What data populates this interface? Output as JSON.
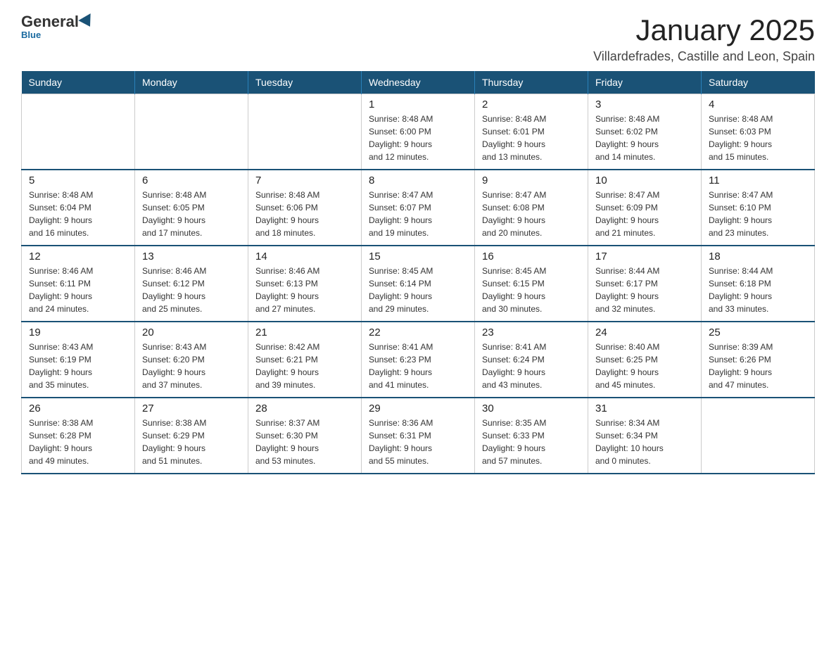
{
  "logo": {
    "general": "General",
    "blue": "Blue"
  },
  "title": "January 2025",
  "subtitle": "Villardefrades, Castille and Leon, Spain",
  "weekdays": [
    "Sunday",
    "Monday",
    "Tuesday",
    "Wednesday",
    "Thursday",
    "Friday",
    "Saturday"
  ],
  "weeks": [
    [
      {
        "day": "",
        "info": ""
      },
      {
        "day": "",
        "info": ""
      },
      {
        "day": "",
        "info": ""
      },
      {
        "day": "1",
        "info": "Sunrise: 8:48 AM\nSunset: 6:00 PM\nDaylight: 9 hours\nand 12 minutes."
      },
      {
        "day": "2",
        "info": "Sunrise: 8:48 AM\nSunset: 6:01 PM\nDaylight: 9 hours\nand 13 minutes."
      },
      {
        "day": "3",
        "info": "Sunrise: 8:48 AM\nSunset: 6:02 PM\nDaylight: 9 hours\nand 14 minutes."
      },
      {
        "day": "4",
        "info": "Sunrise: 8:48 AM\nSunset: 6:03 PM\nDaylight: 9 hours\nand 15 minutes."
      }
    ],
    [
      {
        "day": "5",
        "info": "Sunrise: 8:48 AM\nSunset: 6:04 PM\nDaylight: 9 hours\nand 16 minutes."
      },
      {
        "day": "6",
        "info": "Sunrise: 8:48 AM\nSunset: 6:05 PM\nDaylight: 9 hours\nand 17 minutes."
      },
      {
        "day": "7",
        "info": "Sunrise: 8:48 AM\nSunset: 6:06 PM\nDaylight: 9 hours\nand 18 minutes."
      },
      {
        "day": "8",
        "info": "Sunrise: 8:47 AM\nSunset: 6:07 PM\nDaylight: 9 hours\nand 19 minutes."
      },
      {
        "day": "9",
        "info": "Sunrise: 8:47 AM\nSunset: 6:08 PM\nDaylight: 9 hours\nand 20 minutes."
      },
      {
        "day": "10",
        "info": "Sunrise: 8:47 AM\nSunset: 6:09 PM\nDaylight: 9 hours\nand 21 minutes."
      },
      {
        "day": "11",
        "info": "Sunrise: 8:47 AM\nSunset: 6:10 PM\nDaylight: 9 hours\nand 23 minutes."
      }
    ],
    [
      {
        "day": "12",
        "info": "Sunrise: 8:46 AM\nSunset: 6:11 PM\nDaylight: 9 hours\nand 24 minutes."
      },
      {
        "day": "13",
        "info": "Sunrise: 8:46 AM\nSunset: 6:12 PM\nDaylight: 9 hours\nand 25 minutes."
      },
      {
        "day": "14",
        "info": "Sunrise: 8:46 AM\nSunset: 6:13 PM\nDaylight: 9 hours\nand 27 minutes."
      },
      {
        "day": "15",
        "info": "Sunrise: 8:45 AM\nSunset: 6:14 PM\nDaylight: 9 hours\nand 29 minutes."
      },
      {
        "day": "16",
        "info": "Sunrise: 8:45 AM\nSunset: 6:15 PM\nDaylight: 9 hours\nand 30 minutes."
      },
      {
        "day": "17",
        "info": "Sunrise: 8:44 AM\nSunset: 6:17 PM\nDaylight: 9 hours\nand 32 minutes."
      },
      {
        "day": "18",
        "info": "Sunrise: 8:44 AM\nSunset: 6:18 PM\nDaylight: 9 hours\nand 33 minutes."
      }
    ],
    [
      {
        "day": "19",
        "info": "Sunrise: 8:43 AM\nSunset: 6:19 PM\nDaylight: 9 hours\nand 35 minutes."
      },
      {
        "day": "20",
        "info": "Sunrise: 8:43 AM\nSunset: 6:20 PM\nDaylight: 9 hours\nand 37 minutes."
      },
      {
        "day": "21",
        "info": "Sunrise: 8:42 AM\nSunset: 6:21 PM\nDaylight: 9 hours\nand 39 minutes."
      },
      {
        "day": "22",
        "info": "Sunrise: 8:41 AM\nSunset: 6:23 PM\nDaylight: 9 hours\nand 41 minutes."
      },
      {
        "day": "23",
        "info": "Sunrise: 8:41 AM\nSunset: 6:24 PM\nDaylight: 9 hours\nand 43 minutes."
      },
      {
        "day": "24",
        "info": "Sunrise: 8:40 AM\nSunset: 6:25 PM\nDaylight: 9 hours\nand 45 minutes."
      },
      {
        "day": "25",
        "info": "Sunrise: 8:39 AM\nSunset: 6:26 PM\nDaylight: 9 hours\nand 47 minutes."
      }
    ],
    [
      {
        "day": "26",
        "info": "Sunrise: 8:38 AM\nSunset: 6:28 PM\nDaylight: 9 hours\nand 49 minutes."
      },
      {
        "day": "27",
        "info": "Sunrise: 8:38 AM\nSunset: 6:29 PM\nDaylight: 9 hours\nand 51 minutes."
      },
      {
        "day": "28",
        "info": "Sunrise: 8:37 AM\nSunset: 6:30 PM\nDaylight: 9 hours\nand 53 minutes."
      },
      {
        "day": "29",
        "info": "Sunrise: 8:36 AM\nSunset: 6:31 PM\nDaylight: 9 hours\nand 55 minutes."
      },
      {
        "day": "30",
        "info": "Sunrise: 8:35 AM\nSunset: 6:33 PM\nDaylight: 9 hours\nand 57 minutes."
      },
      {
        "day": "31",
        "info": "Sunrise: 8:34 AM\nSunset: 6:34 PM\nDaylight: 10 hours\nand 0 minutes."
      },
      {
        "day": "",
        "info": ""
      }
    ]
  ]
}
